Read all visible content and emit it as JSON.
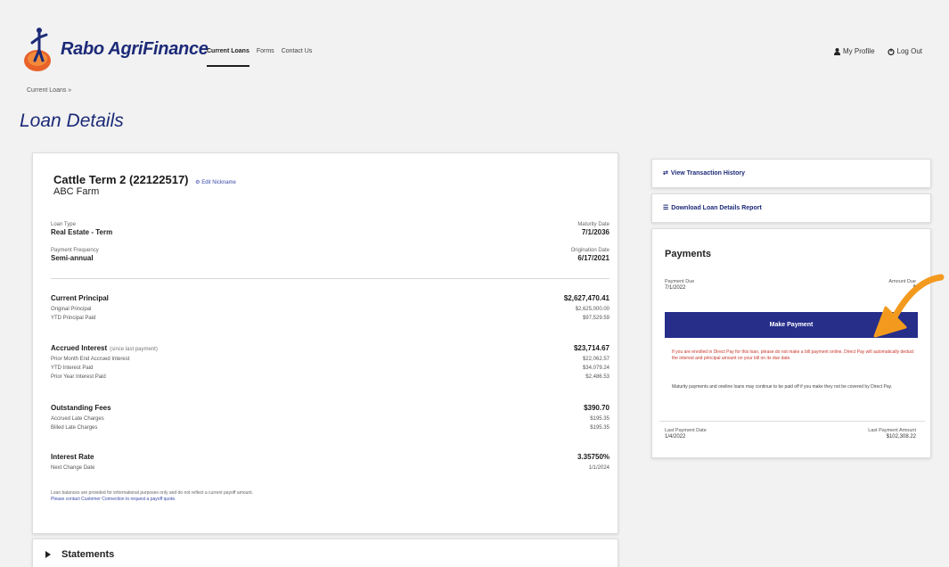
{
  "header": {
    "logo_text": "Rabo AgriFinance",
    "nav": [
      "Current Loans",
      "Forms",
      "Contact Us"
    ],
    "profile_label": "My Profile",
    "logout_label": "Log Out"
  },
  "breadcrumb": "Current Loans »",
  "page_title": "Loan Details",
  "loan": {
    "title": "Cattle Term 2 (22122517)",
    "edit_link": "Edit Nickname",
    "farm": "ABC Farm",
    "loan_type_label": "Loan Type",
    "loan_type": "Real Estate - Term",
    "maturity_label": "Maturity Date",
    "maturity": "7/1/2036",
    "frequency_label": "Payment Frequency",
    "frequency": "Semi-annual",
    "origination_label": "Origination Date",
    "origination": "6/17/2021"
  },
  "sections": {
    "principal": {
      "title": "Current Principal",
      "total": "$2,627,470.41",
      "lines": [
        {
          "label": "Original Principal",
          "value": "$2,625,000.00"
        },
        {
          "label": "YTD Principal Paid",
          "value": "$97,529.59"
        }
      ]
    },
    "interest": {
      "title": "Accrued Interest",
      "note": "(since last payment)",
      "total": "$23,714.67",
      "lines": [
        {
          "label": "Prior Month End Accrued Interest",
          "value": "$22,062.57"
        },
        {
          "label": "YTD Interest Paid",
          "value": "$34,079.24"
        },
        {
          "label": "Prior Year Interest Paid",
          "value": "$2,486.53"
        }
      ]
    },
    "fees": {
      "title": "Outstanding Fees",
      "total": "$390.70",
      "lines": [
        {
          "label": "Accrued Late Charges",
          "value": "$195.35"
        },
        {
          "label": "Billed Late Charges",
          "value": "$195.35"
        }
      ]
    },
    "rate": {
      "title": "Interest Rate",
      "total": "3.35750%",
      "lines": [
        {
          "label": "Next Change Date",
          "value": "1/1/2024"
        }
      ]
    }
  },
  "disclaimer": {
    "text": "Loan balances are provided for informational purposes only and do not reflect a current payoff amount.",
    "link": "Please contact Customer Connection to request a payoff quote."
  },
  "statements_label": "Statements",
  "right": {
    "history_label": "View Transaction History",
    "download_label": "Download Loan Details Report",
    "payments_title": "Payments",
    "due_label": "Payment Due",
    "due_value": "7/1/2022",
    "amount_label": "Amount Due",
    "amount_value": "$",
    "make_payment": "Make Payment",
    "warning": "If you are enrolled in Direct Pay for this loan, please do not make a bill payment online. Direct Pay will automatically deduct the interest and principal amount on your bill on its due date.",
    "note": "Maturity payments and oneline loans may continue to be paid off if you make they not be covered by Direct Pay.",
    "last_date_label": "Last Payment Date",
    "last_date": "1/4/2022",
    "last_amount_label": "Last Payment Amount",
    "last_amount": "$102,308.22"
  },
  "colors": {
    "brand": "#1c2a78",
    "button": "#262e8a",
    "warning": "#c8362a",
    "arrow": "#f39a1e"
  }
}
